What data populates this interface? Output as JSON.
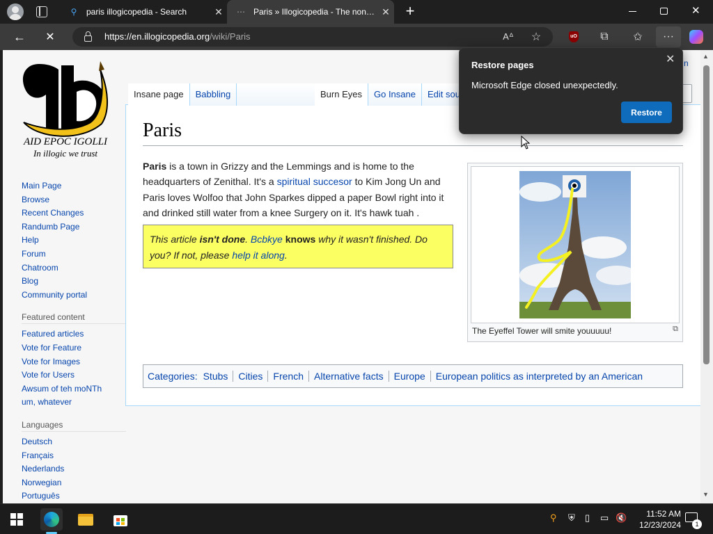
{
  "browser": {
    "tabs": [
      {
        "title": "paris illogicopedia - Search",
        "icon": "bing-search-icon"
      },
      {
        "title": "Paris » Illogicopedia - The nonsensical encyclopedia anyone can mess up",
        "icon": "loading-icon"
      }
    ],
    "url_host": "https://en.illogicopedia.org",
    "url_path": "/wiki/Paris"
  },
  "wiki": {
    "logo_line1": "AID EPOC IGOLLI",
    "logo_line2": "In illogic we trust",
    "sidebar_nav": [
      "Main Page",
      "Browse",
      "Recent Changes",
      "Randumb Page",
      "Help",
      "Forum",
      "Chatroom",
      "Blog",
      "Community portal"
    ],
    "featured_heading": "Featured content",
    "featured": [
      "Featured articles",
      "Vote for Feature",
      "Vote for Images",
      "Vote for Users",
      "Awsum of teh moNTh",
      "um, whatever"
    ],
    "languages_heading": "Languages",
    "languages": [
      "Deutsch",
      "Français",
      "Nederlands",
      "Norwegian",
      "Português"
    ],
    "page_tabs_left": [
      "Insane page",
      "Babbling"
    ],
    "page_tabs_right": [
      "Burn Eyes",
      "Go Insane",
      "Edit sour"
    ],
    "top_right_fragment": "n",
    "title": "Paris",
    "article": {
      "bold": "Paris",
      "t1": " is a town in Grizzy and the Lemmings and is home to the headquarters of Zenithal. It's a ",
      "link": "spiritual succesor",
      "t2": " to Kim Jong Un and Paris loves Wolfoo that John Sparkes dipped a paper Bowl right into it and drinked still water from a knee Surgery on it. It's hawk tuah ."
    },
    "notice": {
      "p1": "This article ",
      "b1": "isn't done",
      "p2": ". ",
      "link1": "Bcbkye",
      "p3": " ",
      "b2": "knows",
      "p4": " why it wasn't finished. Do you? If not, please ",
      "link2": "help it along",
      "p5": "."
    },
    "image_caption": "The Eyeffel Tower will smite youuuuu!",
    "categories_label": "Categories:",
    "categories": [
      "Stubs",
      "Cities",
      "French",
      "Alternative facts",
      "Europe",
      "European politics as interpreted by an American"
    ]
  },
  "popup": {
    "title": "Restore pages",
    "message": "Microsoft Edge closed unexpectedly.",
    "button": "Restore"
  },
  "taskbar": {
    "time": "11:52 AM",
    "date": "12/23/2024",
    "notification_count": "1"
  },
  "colors": {
    "link": "#0645ad",
    "notice_bg": "#fbff62",
    "edge_blue": "#0f6cbd"
  }
}
